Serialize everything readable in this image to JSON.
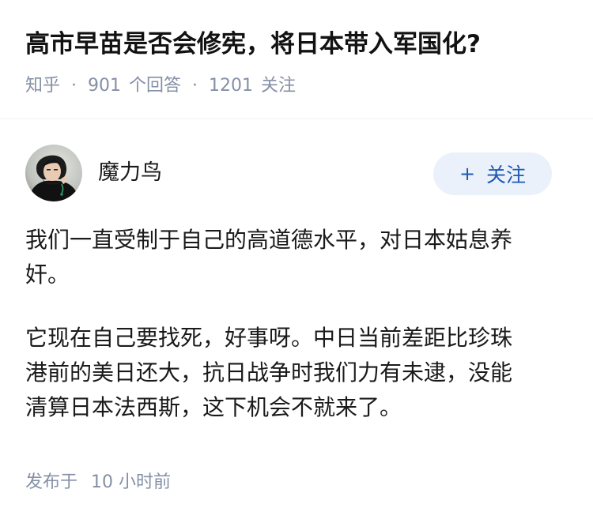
{
  "question": {
    "title": "高市早苗是否会修宪，将日本带入军国化?",
    "meta": {
      "site": "知乎",
      "separator": "·",
      "answers_count": "901",
      "answers_label": "个回答",
      "followers_count": "1201",
      "followers_label": "关注"
    }
  },
  "answer": {
    "author": {
      "name": "魔力鸟",
      "avatar_icon": "person-avatar-icon"
    },
    "follow_button": {
      "icon": "plus-icon",
      "plus_glyph": "+",
      "label": "关注"
    },
    "paragraphs": [
      "我们一直受制于自己的高道德水平，对日本姑息养\n奸。",
      "它现在自己要找死，好事呀。中日当前差距比珍珠\n港前的美日还大，抗日战争时我们力有未逮，没能\n清算日本法西斯，这下机会不就来了。"
    ],
    "published": {
      "label": "发布于",
      "time": "10 小时前"
    }
  },
  "colors": {
    "title": "#121212",
    "meta": "#8590a6",
    "follow_bg": "#ebf1fa",
    "follow_text": "#1e5ab4",
    "divider": "#f0f2f7"
  }
}
